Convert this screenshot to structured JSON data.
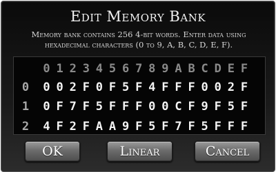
{
  "dialog": {
    "title": "Edit Memory Bank",
    "description_line1": "Memory bank contains 256 4-bit words. Enter data using",
    "description_line2": "hexadecimal characters (0 to 9, A, B, C, D, E, F)."
  },
  "grid": {
    "header": [
      "0",
      "1",
      "2",
      "3",
      "4",
      "5",
      "6",
      "7",
      "8",
      "9",
      "A",
      "B",
      "C",
      "D",
      "E",
      "F"
    ],
    "rows": [
      {
        "index": "0",
        "cells": [
          "0",
          "0",
          "2",
          "F",
          "0",
          "F",
          "5",
          "F",
          "4",
          "F",
          "F",
          "F",
          "0",
          "0",
          "2",
          "F"
        ]
      },
      {
        "index": "1",
        "cells": [
          "0",
          "F",
          "7",
          "F",
          "5",
          "F",
          "F",
          "F",
          "0",
          "0",
          "C",
          "F",
          "9",
          "F",
          "5",
          "F"
        ]
      },
      {
        "index": "2",
        "cells": [
          "4",
          "F",
          "2",
          "F",
          "A",
          "A",
          "9",
          "F",
          "5",
          "F",
          "7",
          "F",
          "5",
          "F",
          "F",
          "F"
        ]
      }
    ]
  },
  "buttons": {
    "ok": "OK",
    "linear": "Linear",
    "cancel": "Cancel"
  }
}
